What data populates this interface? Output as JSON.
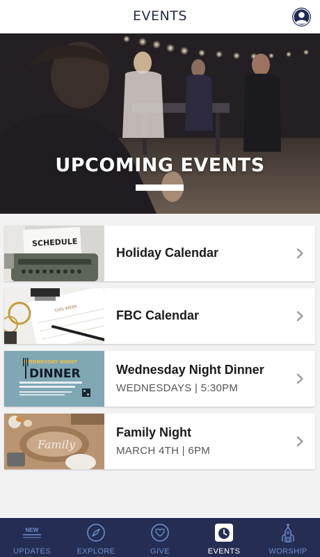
{
  "header": {
    "title": "EVENTS"
  },
  "hero": {
    "title": "UPCOMING EVENTS"
  },
  "events": [
    {
      "title": "Holiday Calendar",
      "subtitle": "",
      "thumb_text": "SCHEDULE"
    },
    {
      "title": "FBC Calendar",
      "subtitle": "",
      "thumb_text": "THIS WEEK"
    },
    {
      "title": "Wednesday Night Dinner",
      "subtitle": "WEDNESDAYS | 5:30PM",
      "thumb_text_top": "WEDNESDAY NIGHT",
      "thumb_text_main": "DINNER"
    },
    {
      "title": "Family Night",
      "subtitle": "MARCH 4TH | 6PM",
      "thumb_text": "Family"
    }
  ],
  "tabbar": {
    "items": [
      {
        "label": "UPDATES",
        "badge": "NEW",
        "icon": "updates-icon",
        "active": false
      },
      {
        "label": "EXPLORE",
        "icon": "compass-icon",
        "active": false
      },
      {
        "label": "GIVE",
        "icon": "heart-icon",
        "active": false
      },
      {
        "label": "EVENTS",
        "icon": "calendar-clock-icon",
        "active": true
      },
      {
        "label": "WORSHIP",
        "icon": "church-icon",
        "active": false
      }
    ]
  },
  "colors": {
    "header_text": "#232b4a",
    "tabbar_bg": "#252d52",
    "tab_inactive": "#6f8fcf",
    "tab_active": "#ffffff"
  }
}
